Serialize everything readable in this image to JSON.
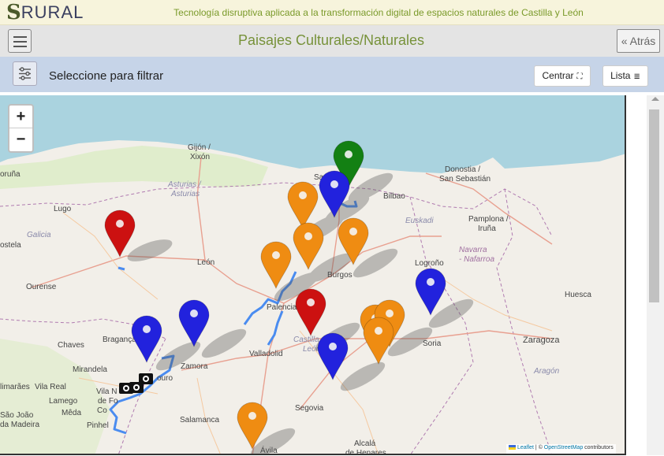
{
  "banner": {
    "logo_s": "S",
    "logo_text": "RURAL",
    "tagline": "Tecnología disruptiva aplicada a la transformación digital de espacios naturales de Castilla y León"
  },
  "header": {
    "menu_icon": "hamburger-icon",
    "title": "Paisajes Culturales/Naturales",
    "back_label": "« Atrás"
  },
  "filterbar": {
    "filter_icon": "sliders-icon",
    "label": "Seleccione para filtrar",
    "center_label": "Centrar",
    "center_icon": "crosshair-icon",
    "list_label": "Lista",
    "list_icon": "list-icon"
  },
  "map": {
    "zoom_in": "+",
    "zoom_out": "−",
    "attribution_leaflet": "Leaflet",
    "attribution_sep": " | © ",
    "attribution_osm": "OpenStreetMap",
    "attribution_tail": " contributors",
    "colors": {
      "green": "#138013",
      "red": "#cc1111",
      "blue": "#2222dd",
      "orange": "#ef8c12",
      "route": "#4a8cf0"
    },
    "labels": {
      "gijon": "Gijón /",
      "xixon": "Xixón",
      "asturias1": "Asturias /",
      "asturias2": "Asturias",
      "santander": "Santander",
      "bilbao": "Bilbao",
      "donostia": "Donostia /",
      "sansebastian": "San Sebastián",
      "euskadi": "Euskadi",
      "pamplona": "Pamplona /",
      "iruna": "Iruña",
      "navarra": "Navarra",
      "nafarroa": "- Nafarroa",
      "logrono": "Logroño",
      "lugo": "Lugo",
      "galicia": "Galicia",
      "ostela": "ostela",
      "coruna": "oruña",
      "leon": "León",
      "burgos": "Burgos",
      "ourense": "Ourense",
      "palencia": "Palencia",
      "huesca": "Huesca",
      "braganca": "Bragança",
      "chaves": "Chaves",
      "castilla": "Castilla y",
      "castilla2": "León",
      "soria": "Soria",
      "zaragoza": "Zaragoza",
      "valladolid": "Valladolid",
      "zamora": "Zamora",
      "mirandela": "Mirandela",
      "aragon": "Aragón",
      "vilareal": "Vila Real",
      "lamego": "Lamego",
      "mimaraes": "limarães",
      "vilanova": "Vila N",
      "deFoz": "de Fo",
      "mirandadouro": "ouro",
      "co": "Co",
      "meda": "Mêda",
      "segovia": "Segovia",
      "sajoao": "São João",
      "damadeira": "da Madeira",
      "pinhel": "Pinhel",
      "salamanca": "Salamanca",
      "alcala1": "Alcalá",
      "alcala2": "de Henares",
      "avila": "Ávila",
      "no": "o"
    }
  }
}
